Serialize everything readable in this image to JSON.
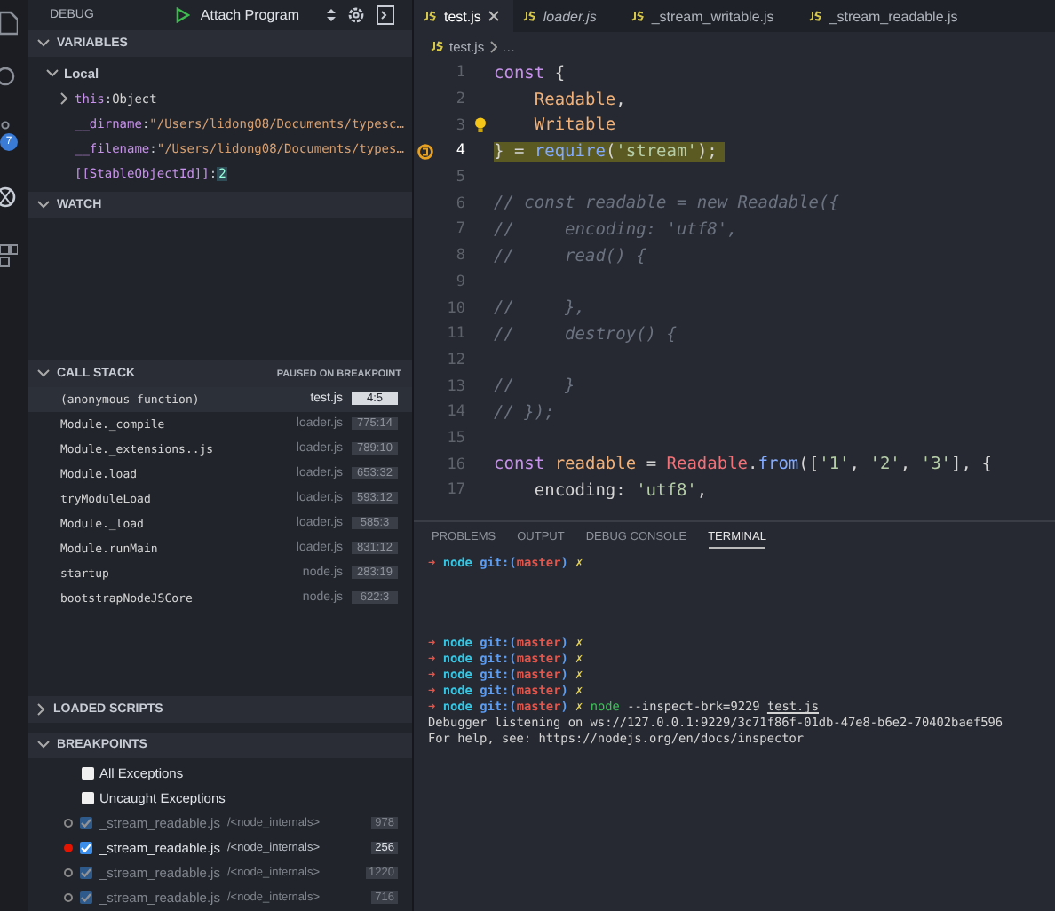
{
  "debug_toolbar": {
    "title": "DEBUG",
    "configuration": "Attach Program"
  },
  "activity_bar": {
    "badge": "7"
  },
  "variables": {
    "title": "VARIABLES",
    "expanded": true,
    "scope": {
      "label": "Local",
      "expanded": true
    },
    "items": [
      {
        "name": "this",
        "colon": ":",
        "value": "Object",
        "expandable": true,
        "kind": "object"
      },
      {
        "name": "__dirname",
        "colon": ":",
        "value": "\"/Users/lidong08/Documents/typesc…",
        "expandable": false,
        "kind": "string"
      },
      {
        "name": "__filename",
        "colon": ":",
        "value": "\"/Users/lidong08/Documents/types…",
        "expandable": false,
        "kind": "string"
      },
      {
        "name": "[[StableObjectId]]",
        "colon": ":",
        "value": "2",
        "expandable": false,
        "kind": "number"
      }
    ]
  },
  "watch": {
    "title": "WATCH",
    "expanded": true
  },
  "call_stack": {
    "title": "CALL STACK",
    "status": "PAUSED ON BREAKPOINT",
    "frames": [
      {
        "name": "(anonymous function)",
        "file": "test.js",
        "position": "4:5",
        "selected": true
      },
      {
        "name": "Module._compile",
        "file": "loader.js",
        "position": "775:14",
        "selected": false
      },
      {
        "name": "Module._extensions..js",
        "file": "loader.js",
        "position": "789:10",
        "selected": false
      },
      {
        "name": "Module.load",
        "file": "loader.js",
        "position": "653:32",
        "selected": false
      },
      {
        "name": "tryModuleLoad",
        "file": "loader.js",
        "position": "593:12",
        "selected": false
      },
      {
        "name": "Module._load",
        "file": "loader.js",
        "position": "585:3",
        "selected": false
      },
      {
        "name": "Module.runMain",
        "file": "loader.js",
        "position": "831:12",
        "selected": false
      },
      {
        "name": "startup",
        "file": "node.js",
        "position": "283:19",
        "selected": false
      },
      {
        "name": "bootstrapNodeJSCore",
        "file": "node.js",
        "position": "622:3",
        "selected": false
      }
    ]
  },
  "loaded_scripts": {
    "title": "LOADED SCRIPTS",
    "expanded": false
  },
  "breakpoints": {
    "title": "BREAKPOINTS",
    "expanded": true,
    "exceptions": [
      {
        "label": "All Exceptions",
        "checked": false
      },
      {
        "label": "Uncaught Exceptions",
        "checked": false
      }
    ],
    "items": [
      {
        "file": "_stream_readable.js",
        "path": "/<node_internals>",
        "line": "978",
        "checked": true,
        "active": false
      },
      {
        "file": "_stream_readable.js",
        "path": "/<node_internals>",
        "line": "256",
        "checked": true,
        "active": true
      },
      {
        "file": "_stream_readable.js",
        "path": "/<node_internals>",
        "line": "1220",
        "checked": true,
        "active": false
      },
      {
        "file": "_stream_readable.js",
        "path": "/<node_internals>",
        "line": "716",
        "checked": true,
        "active": false
      }
    ]
  },
  "editor_tabs": [
    {
      "label": "test.js",
      "selected": true,
      "italic": false
    },
    {
      "label": "loader.js",
      "selected": false,
      "italic": true
    },
    {
      "label": "_stream_writable.js",
      "selected": false,
      "italic": false
    },
    {
      "label": "_stream_readable.js",
      "selected": false,
      "italic": false
    }
  ],
  "breadcrumb": {
    "file": "test.js",
    "rest": "…"
  },
  "code_lines": [
    {
      "number": "1",
      "current": false,
      "tokens": [
        {
          "kind": "keyword",
          "text": "const "
        },
        {
          "kind": "punct",
          "text": "{"
        }
      ]
    },
    {
      "number": "2",
      "current": false,
      "indent": true,
      "tokens": [
        {
          "kind": "var",
          "text": "Readable"
        },
        {
          "kind": "punct",
          "text": ","
        }
      ]
    },
    {
      "number": "3",
      "current": false,
      "indent": true,
      "bulb": true,
      "tokens": [
        {
          "kind": "var",
          "text": "Writable"
        }
      ]
    },
    {
      "number": "4",
      "current": true,
      "tokens": [
        {
          "kind": "punct",
          "text": "} = "
        },
        {
          "kind": "func",
          "text": "require"
        },
        {
          "kind": "punct",
          "text": "("
        },
        {
          "kind": "string",
          "text": "'stream'"
        },
        {
          "kind": "punct",
          "text": ");"
        }
      ]
    },
    {
      "number": "5",
      "current": false
    },
    {
      "number": "6",
      "current": false,
      "tokens": [
        {
          "kind": "comment",
          "text": "// const readable = new Readable({"
        }
      ]
    },
    {
      "number": "7",
      "current": false,
      "tokens": [
        {
          "kind": "comment",
          "text": "//     encoding: 'utf8',"
        }
      ]
    },
    {
      "number": "8",
      "current": false,
      "tokens": [
        {
          "kind": "comment",
          "text": "//     read() {"
        }
      ]
    },
    {
      "number": "9",
      "current": false
    },
    {
      "number": "10",
      "current": false,
      "tokens": [
        {
          "kind": "comment",
          "text": "//     },"
        }
      ]
    },
    {
      "number": "11",
      "current": false,
      "tokens": [
        {
          "kind": "comment",
          "text": "//     destroy() {"
        }
      ]
    },
    {
      "number": "12",
      "current": false
    },
    {
      "number": "13",
      "current": false,
      "tokens": [
        {
          "kind": "comment",
          "text": "//     }"
        }
      ]
    },
    {
      "number": "14",
      "current": false,
      "tokens": [
        {
          "kind": "comment",
          "text": "// });"
        }
      ]
    },
    {
      "number": "15",
      "current": false
    },
    {
      "number": "16",
      "current": false,
      "tokens": [
        {
          "kind": "keyword",
          "text": "const "
        },
        {
          "kind": "var",
          "text": "readable"
        },
        {
          "kind": "punct",
          "text": " = "
        },
        {
          "kind": "class",
          "text": "Readable"
        },
        {
          "kind": "punct",
          "text": "."
        },
        {
          "kind": "func",
          "text": "from"
        },
        {
          "kind": "punct",
          "text": "(["
        },
        {
          "kind": "string",
          "text": "'1'"
        },
        {
          "kind": "punct",
          "text": ", "
        },
        {
          "kind": "string",
          "text": "'2'"
        },
        {
          "kind": "punct",
          "text": ", "
        },
        {
          "kind": "string",
          "text": "'3'"
        },
        {
          "kind": "punct",
          "text": "], {"
        }
      ]
    },
    {
      "number": "17",
      "current": false,
      "indent": true,
      "tokens": [
        {
          "kind": "plain",
          "text": "encoding: "
        },
        {
          "kind": "string",
          "text": "'utf8'"
        },
        {
          "kind": "punct",
          "text": ","
        }
      ]
    }
  ],
  "panel_tabs": [
    {
      "label": "PROBLEMS",
      "selected": false
    },
    {
      "label": "OUTPUT",
      "selected": false
    },
    {
      "label": "DEBUG CONSOLE",
      "selected": false
    },
    {
      "label": "TERMINAL",
      "selected": true
    }
  ],
  "terminal_lines": [
    {
      "kind": "prompt",
      "arrow": "➜",
      "dir": "node",
      "git": "git:(",
      "branch": "master",
      "git_end": ")",
      "dirty": "✗"
    },
    {
      "kind": "blank"
    },
    {
      "kind": "blank"
    },
    {
      "kind": "blank"
    },
    {
      "kind": "blank"
    },
    {
      "kind": "prompt",
      "arrow": "➜",
      "dir": "node",
      "git": "git:(",
      "branch": "master",
      "git_end": ")",
      "dirty": "✗"
    },
    {
      "kind": "prompt",
      "arrow": "➜",
      "dir": "node",
      "git": "git:(",
      "branch": "master",
      "git_end": ")",
      "dirty": "✗"
    },
    {
      "kind": "prompt",
      "arrow": "➜",
      "dir": "node",
      "git": "git:(",
      "branch": "master",
      "git_end": ")",
      "dirty": "✗"
    },
    {
      "kind": "prompt",
      "arrow": "➜",
      "dir": "node",
      "git": "git:(",
      "branch": "master",
      "git_end": ")",
      "dirty": "✗"
    },
    {
      "kind": "prompt",
      "arrow": "➜",
      "dir": "node",
      "git": "git:(",
      "branch": "master",
      "git_end": ")",
      "dirty": "✗",
      "command": "node",
      "args": " --inspect-brk=9229 ",
      "file": "test.js"
    },
    {
      "kind": "output",
      "text": "Debugger listening on ws://127.0.0.1:9229/3c71f86f-01db-47e8-b6e2-70402baef596"
    },
    {
      "kind": "output",
      "text": "For help, see: https://nodejs.org/en/docs/inspector"
    }
  ]
}
